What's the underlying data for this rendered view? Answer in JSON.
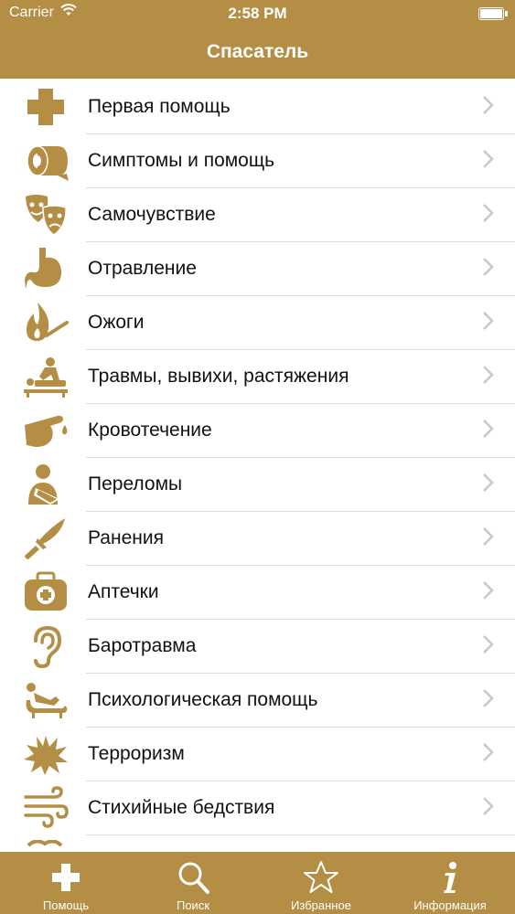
{
  "status_bar": {
    "carrier": "Carrier",
    "time": "2:58 PM"
  },
  "nav": {
    "title": "Спасатель"
  },
  "colors": {
    "accent": "#b58e45",
    "icon": "#b58e45",
    "separator": "#dcdcdc",
    "chevron": "#c7c7cc"
  },
  "list": {
    "items": [
      {
        "label": "Первая помощь",
        "icon": "medical-cross-icon"
      },
      {
        "label": "Симптомы и помощь",
        "icon": "bandage-roll-icon"
      },
      {
        "label": "Самочувствие",
        "icon": "theater-masks-icon"
      },
      {
        "label": "Отравление",
        "icon": "stomach-icon"
      },
      {
        "label": "Ожоги",
        "icon": "match-flame-icon"
      },
      {
        "label": "Травмы, вывихи, растяжения",
        "icon": "massage-icon"
      },
      {
        "label": "Кровотечение",
        "icon": "bleeding-finger-icon"
      },
      {
        "label": "Переломы",
        "icon": "arm-sling-icon"
      },
      {
        "label": "Ранения",
        "icon": "knife-icon"
      },
      {
        "label": "Аптечки",
        "icon": "first-aid-kit-icon"
      },
      {
        "label": "Баротравма",
        "icon": "ear-icon"
      },
      {
        "label": "Психологическая помощь",
        "icon": "couch-icon"
      },
      {
        "label": "Терроризм",
        "icon": "explosion-icon"
      },
      {
        "label": "Стихийные бедствия",
        "icon": "wind-icon"
      }
    ]
  },
  "tabbar": {
    "tabs": [
      {
        "label": "Помощь",
        "icon": "plus-icon"
      },
      {
        "label": "Поиск",
        "icon": "search-icon"
      },
      {
        "label": "Избранное",
        "icon": "star-icon"
      },
      {
        "label": "Информация",
        "icon": "info-icon"
      }
    ]
  }
}
